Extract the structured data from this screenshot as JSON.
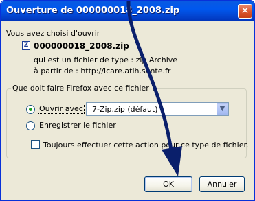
{
  "window": {
    "title": "Ouverture de 000000018_2008.zip"
  },
  "dialog": {
    "intro": "Vous avez choisi d'ouvrir",
    "file_name": "000000018_2008.zip",
    "type_line": "qui est un fichier de type : zip Archive",
    "from_line": "à partir de : http://icare.atih.sante.fr",
    "group_title": "Que doit faire Firefox avec ce fichier ?",
    "open_with_label": "Ouvrir avec",
    "open_with_app": "7-Zip.zip (défaut)",
    "save_label": "Enregistrer le fichier",
    "remember_label": "Toujours effectuer cette action pour ce type de fichier.",
    "ok_label": "OK",
    "cancel_label": "Annuler"
  },
  "state": {
    "open_with_selected": true,
    "save_selected": false,
    "remember_checked": false
  },
  "icons": {
    "close": "close-icon",
    "file": "zip-file-icon",
    "dropdown": "chevron-down-icon",
    "annotation": "arrow-icon"
  },
  "colors": {
    "titlebar": "#0058ee",
    "close": "#d9532c",
    "arrow": "#0a1f6b",
    "radio_dot": "#21a121"
  }
}
